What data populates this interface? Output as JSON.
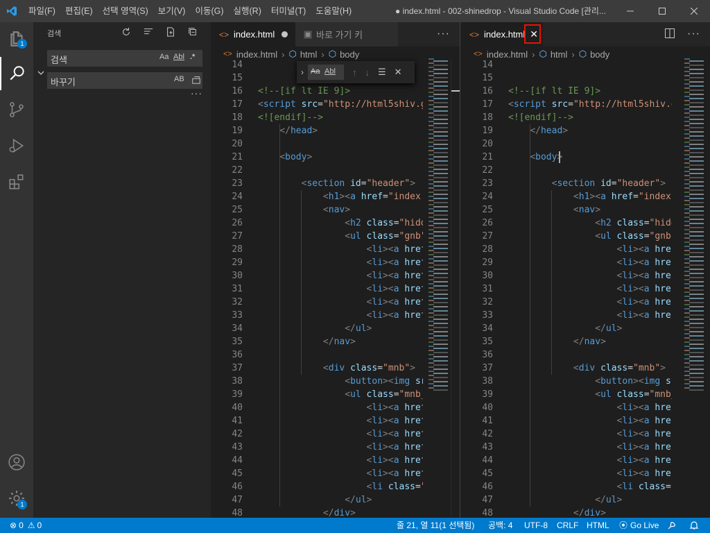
{
  "titlebar": {
    "menus": [
      "파일(F)",
      "편집(E)",
      "선택 영역(S)",
      "보기(V)",
      "이동(G)",
      "실행(R)",
      "터미널(T)",
      "도움말(H)"
    ],
    "window_title": "● index.html - 002-shinedrop - Visual Studio Code [관리..."
  },
  "activity": {
    "explorer_badge": "1",
    "settings_badge": "1"
  },
  "sidebar": {
    "title": "검색",
    "search_placeholder": "검색",
    "search_opts": [
      "Aa",
      "Abl",
      ".*"
    ],
    "replace_placeholder": "바꾸기",
    "replace_opt": "AB"
  },
  "left_group": {
    "tabs": [
      {
        "label": "index.html",
        "modified": true
      },
      {
        "label": "바로 가기 키"
      }
    ],
    "breadcrumb": [
      "index.html",
      "html",
      "body"
    ]
  },
  "right_group": {
    "tabs": [
      {
        "label": "index.html"
      }
    ],
    "breadcrumb": [
      "index.html",
      "html",
      "body"
    ]
  },
  "find_widget": {
    "case_label": "Aa",
    "word_label": "Abl"
  },
  "code": {
    "line_numbers": [
      "14",
      "15",
      "16",
      "17",
      "18",
      "19",
      "20",
      "21",
      "22",
      "23",
      "24",
      "25",
      "26",
      "27",
      "28",
      "29",
      "30",
      "31",
      "32",
      "33",
      "34",
      "35",
      "36",
      "37",
      "38",
      "39",
      "40",
      "41",
      "42",
      "43",
      "44",
      "45",
      "46",
      "47",
      "48"
    ]
  },
  "statusbar": {
    "problems": "0",
    "warnings": "0",
    "position": "줄 21, 열 11(1 선택됨)",
    "spaces": "공백: 4",
    "encoding": "UTF-8",
    "eol": "CRLF",
    "language": "HTML",
    "golive": "Go Live"
  },
  "colors": {
    "accent": "#007acc",
    "highlight_box": "#e51400"
  }
}
